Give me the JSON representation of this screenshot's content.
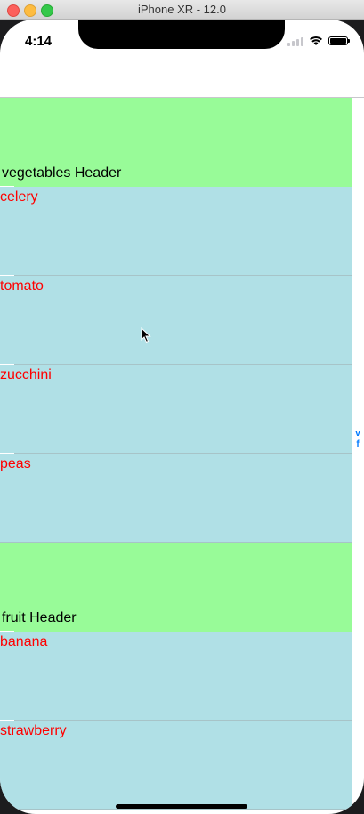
{
  "window": {
    "title": "iPhone XR - 12.0"
  },
  "status_bar": {
    "time": "4:14"
  },
  "sections": [
    {
      "header": "vegetables Header",
      "items": [
        "celery",
        "tomato",
        "zucchini",
        "peas"
      ]
    },
    {
      "header": "fruit Header",
      "items": [
        "banana",
        "strawberry"
      ]
    }
  ],
  "index_bar": [
    "v",
    "f"
  ],
  "colors": {
    "header_bg": "#98fb98",
    "row_bg": "#b0e0e6",
    "row_text": "#ff0000",
    "index_text": "#007aff"
  }
}
